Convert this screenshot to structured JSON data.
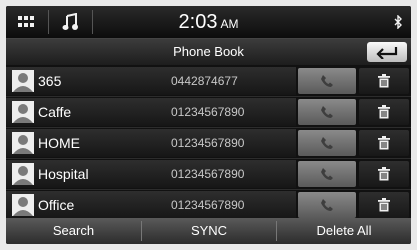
{
  "status_bar": {
    "menu_icon": "grid-menu-icon",
    "music_icon": "music-note-icon",
    "time": "2:03",
    "ampm": "AM",
    "bluetooth_icon": "bluetooth-icon"
  },
  "title_bar": {
    "title": "Phone Book",
    "back_icon": "back-arrow-icon"
  },
  "contacts": [
    {
      "name": "365",
      "number": "0442874677"
    },
    {
      "name": "Caffe",
      "number": "01234567890"
    },
    {
      "name": "HOME",
      "number": "01234567890"
    },
    {
      "name": "Hospital",
      "number": "01234567890"
    },
    {
      "name": "Office",
      "number": "01234567890"
    }
  ],
  "row_icons": {
    "avatar": "person-avatar-icon",
    "call": "phone-handset-icon",
    "delete": "trash-icon"
  },
  "bottom_bar": {
    "search": "Search",
    "sync": "SYNC",
    "delete_all": "Delete All"
  },
  "colors": {
    "background": "#111111",
    "call_button": "#777777",
    "text": "#ffffff"
  }
}
